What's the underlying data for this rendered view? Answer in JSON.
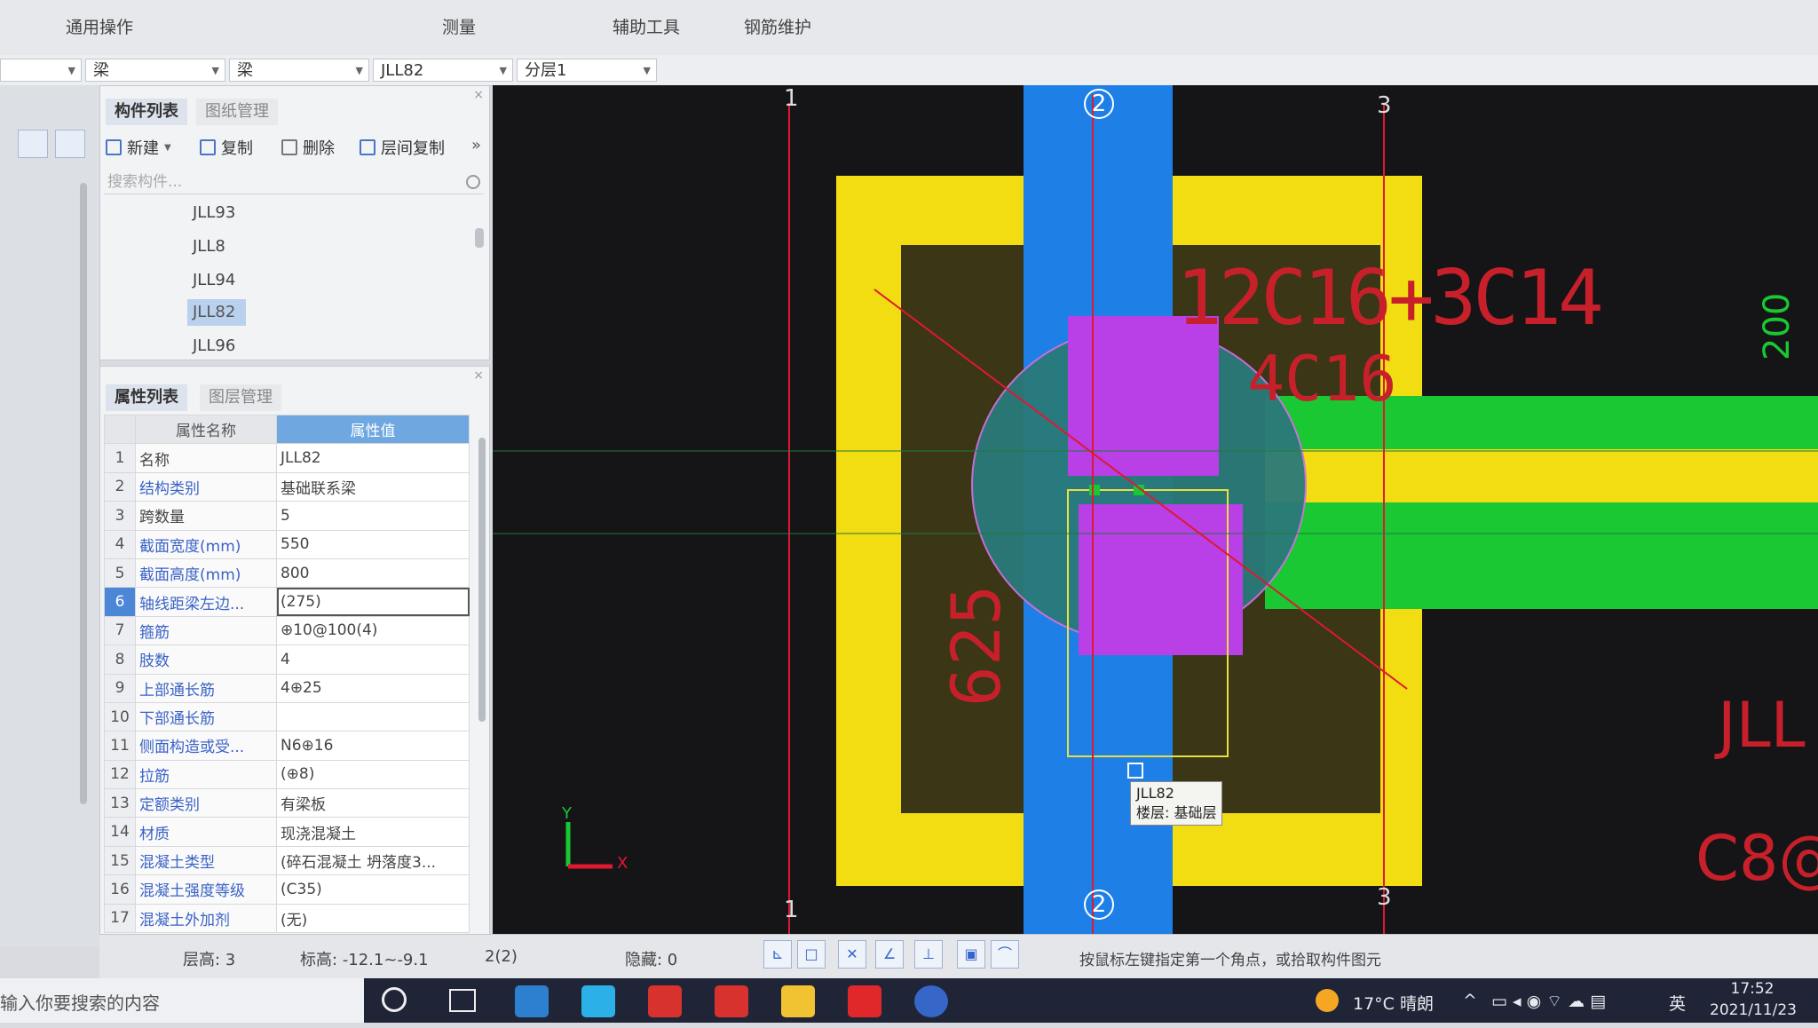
{
  "ribbon": {
    "groups": [
      "通用操作",
      "测量",
      "辅助工具",
      "钢筋维护"
    ]
  },
  "toolbar": {
    "combo1": "梁",
    "combo2": "梁",
    "combo3": "JLL82",
    "combo4": "分层1"
  },
  "component_panel": {
    "tabs": [
      "构件列表",
      "图纸管理"
    ],
    "tools": [
      "新建",
      "复制",
      "删除",
      "层间复制"
    ],
    "more": "»",
    "search_placeholder": "搜索构件...",
    "items": [
      "JLL93",
      "JLL8",
      "JLL94",
      "JLL82",
      "JLL96"
    ],
    "selected": "JLL82"
  },
  "property_panel": {
    "tabs": [
      "属性列表",
      "图层管理"
    ],
    "headers": [
      "属性名称",
      "属性值"
    ],
    "rows": [
      {
        "num": "1",
        "name": "名称",
        "value": "JLL82"
      },
      {
        "num": "2",
        "name": "结构类别",
        "value": "基础联系梁"
      },
      {
        "num": "3",
        "name": "跨数量",
        "value": "5"
      },
      {
        "num": "4",
        "name": "截面宽度(mm)",
        "value": "550"
      },
      {
        "num": "5",
        "name": "截面高度(mm)",
        "value": "800"
      },
      {
        "num": "6",
        "name": "轴线距梁左边...",
        "value": "(275)"
      },
      {
        "num": "7",
        "name": "箍筋",
        "value": "⊕10@100(4)"
      },
      {
        "num": "8",
        "name": "肢数",
        "value": "4"
      },
      {
        "num": "9",
        "name": "上部通长筋",
        "value": "4⊕25"
      },
      {
        "num": "10",
        "name": "下部通长筋",
        "value": ""
      },
      {
        "num": "11",
        "name": "侧面构造或受...",
        "value": "N6⊕16"
      },
      {
        "num": "12",
        "name": "拉筋",
        "value": "(⊕8)"
      },
      {
        "num": "13",
        "name": "定额类别",
        "value": "有梁板"
      },
      {
        "num": "14",
        "name": "材质",
        "value": "现浇混凝土"
      },
      {
        "num": "15",
        "name": "混凝土类型",
        "value": "(碎石混凝土 坍落度3..."
      },
      {
        "num": "16",
        "name": "混凝土强度等级",
        "value": "(C35)"
      },
      {
        "num": "17",
        "name": "混凝土外加剂",
        "value": "(无)"
      }
    ]
  },
  "canvas": {
    "axis_top": [
      "1",
      "2",
      "3"
    ],
    "axis_bottom": [
      "1",
      "2",
      "3"
    ],
    "rebar_text_1": "12C16+3C14",
    "rebar_text_2": "4C16",
    "dim_text": "625",
    "side_text_1": "JLL",
    "side_text_2": "C8@",
    "side_text_3": "200",
    "tooltip_line1": "JLL82",
    "tooltip_line2": "楼层: 基础层",
    "axis_x": "X",
    "axis_y": "Y"
  },
  "status": {
    "floor_height": "层高:  3",
    "elevation": "标高:  -12.1~-9.1",
    "count": "2(2)",
    "hidden": "隐藏:  0",
    "hint": "按鼠标左键指定第一个角点，或拾取构件图元"
  },
  "taskbar": {
    "search_placeholder": "输入你要搜索的内容",
    "weather": "17°C  晴朗",
    "ime": "英",
    "time": "17:52",
    "date": "2021/11/23"
  },
  "colors": {
    "slab_yellow": "#f2dc12",
    "column_blue": "#1e7fe6",
    "beam_green": "#19c832",
    "purple": "#b93fe6",
    "circle_teal": "#2a7a7a",
    "dark_fill": "#3a3616",
    "axis_red": "#e01830"
  }
}
